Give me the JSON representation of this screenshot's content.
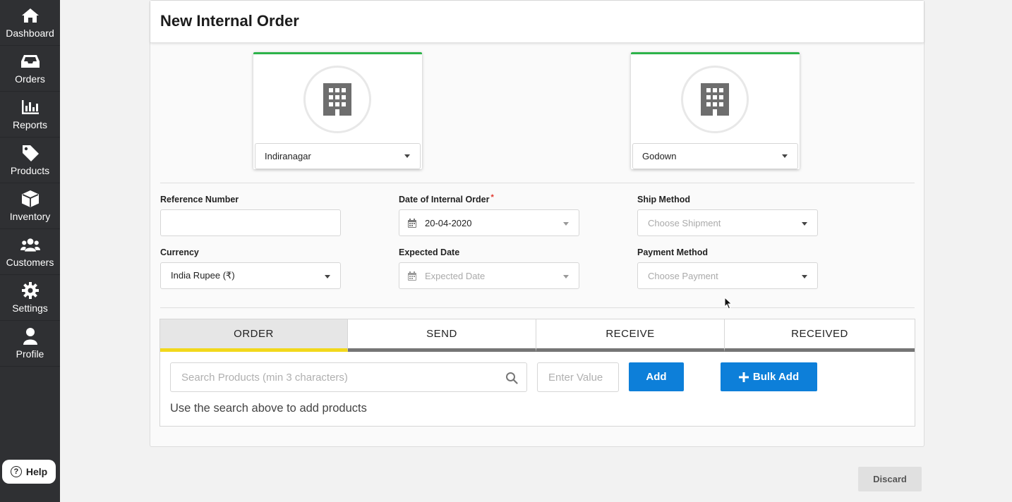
{
  "sidebar": {
    "items": [
      {
        "label": "Dashboard",
        "icon": "home-icon"
      },
      {
        "label": "Orders",
        "icon": "inbox-icon"
      },
      {
        "label": "Reports",
        "icon": "bar-chart-icon"
      },
      {
        "label": "Products",
        "icon": "tag-icon"
      },
      {
        "label": "Inventory",
        "icon": "box-icon"
      },
      {
        "label": "Customers",
        "icon": "users-icon"
      },
      {
        "label": "Settings",
        "icon": "gear-icon"
      },
      {
        "label": "Profile",
        "icon": "user-icon"
      }
    ],
    "help_label": "Help"
  },
  "page": {
    "title": "New Internal Order"
  },
  "locations": {
    "source": "Indiranagar",
    "destination": "Godown"
  },
  "form": {
    "reference_number": {
      "label": "Reference Number",
      "value": ""
    },
    "date": {
      "label": "Date of Internal Order",
      "required_mark": "*",
      "value": "20-04-2020"
    },
    "ship_method": {
      "label": "Ship Method",
      "placeholder": "Choose Shipment"
    },
    "currency": {
      "label": "Currency",
      "value": "India Rupee (₹)"
    },
    "expected_date": {
      "label": "Expected Date",
      "placeholder": "Expected Date"
    },
    "payment_method": {
      "label": "Payment Method",
      "placeholder": "Choose Payment"
    }
  },
  "tabs": [
    {
      "label": "ORDER",
      "active": true
    },
    {
      "label": "SEND",
      "active": false
    },
    {
      "label": "RECEIVE",
      "active": false
    },
    {
      "label": "RECEIVED",
      "active": false
    }
  ],
  "products": {
    "search_placeholder": "Search Products (min 3 characters)",
    "value_placeholder": "Enter Value",
    "add_label": "Add",
    "bulk_add_label": "Bulk Add",
    "hint": "Use the search above to add products"
  },
  "footer": {
    "discard_label": "Discard"
  },
  "colors": {
    "sidebar_bg": "#2f3033",
    "accent_blue": "#0d7fd9",
    "active_tab_underline": "#f2d81c",
    "location_card_border": "#2db34a",
    "required": "#e0352b"
  }
}
